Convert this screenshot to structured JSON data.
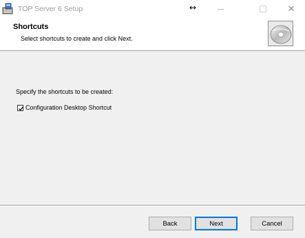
{
  "window": {
    "title": "TOP Server 6 Setup",
    "icons": {
      "app": "installer-icon",
      "cursor": "resize-horizontal-icon"
    }
  },
  "banner": {
    "title": "Shortcuts",
    "subtitle": "Select shortcuts to create and click Next.",
    "art_icon": "cd-disc-icon"
  },
  "body": {
    "prompt": "Specify the shortcuts to be created:",
    "shortcuts": [
      {
        "label": "Configuration Desktop Shortcut",
        "checked": true
      }
    ]
  },
  "footer": {
    "back_label": "Back",
    "next_label": "Next",
    "cancel_label": "Cancel"
  },
  "colors": {
    "default_button_border": "#0078d7",
    "window_background": "#f0f0f0",
    "banner_background": "#ffffff"
  }
}
